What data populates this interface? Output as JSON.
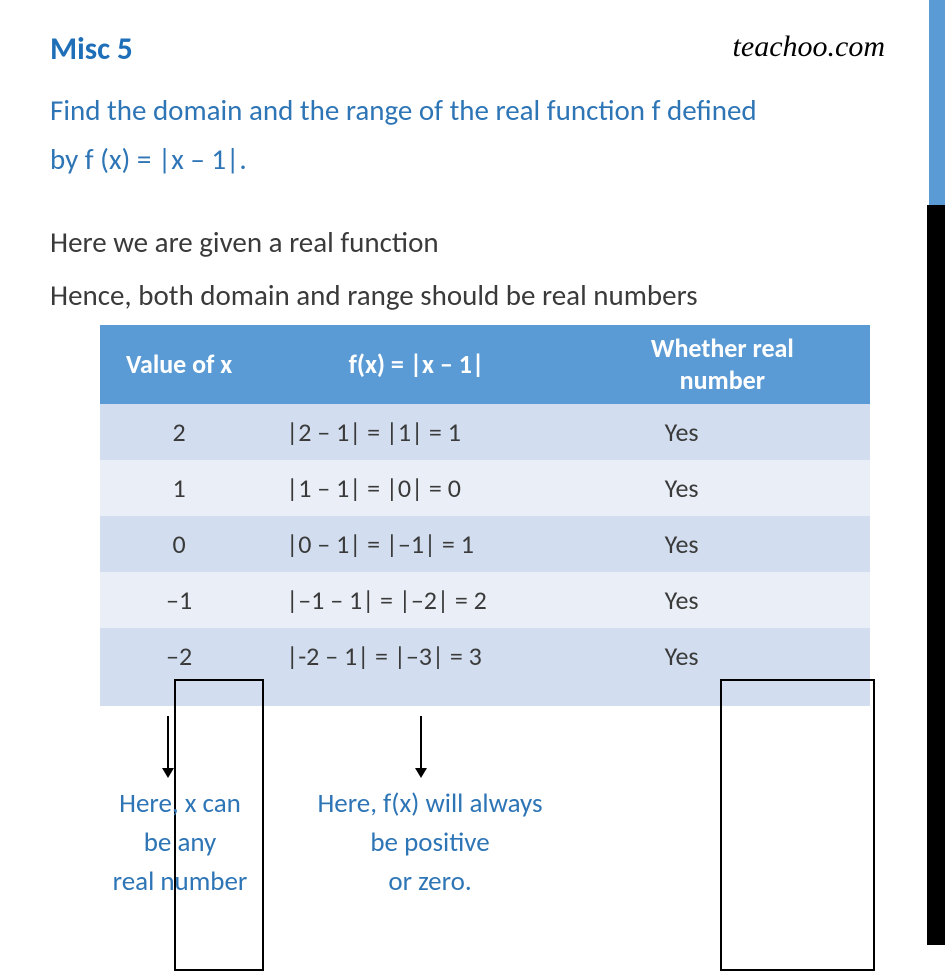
{
  "brand": "teachoo.com",
  "title": "Misc  5",
  "problem_line1": "Find the domain and the range of the real function f defined",
  "problem_line2": "by f (x) = |x – 1|.",
  "solution_line1": "Here we are given a real function",
  "solution_line2": "Hence, both domain and range should be real numbers",
  "table": {
    "headers": {
      "col1": "Value of x",
      "col2": "f(x) = |x – 1|",
      "col3_l1": "Whether real",
      "col3_l2": "number"
    },
    "rows": [
      {
        "x": "2",
        "fx": "|2 – 1| = |1| = 1",
        "real": "Yes"
      },
      {
        "x": "1",
        "fx": "|1 – 1| = |0| = 0",
        "real": "Yes"
      },
      {
        "x": "0",
        "fx": "|0 – 1| = |–1| = 1",
        "real": "Yes"
      },
      {
        "x": "–1",
        "fx": "|–1 – 1| = |–2| = 2",
        "real": "Yes"
      },
      {
        "x": "–2",
        "fx": "|-2 – 1| = |–3| = 3",
        "real": "Yes"
      }
    ]
  },
  "notes": {
    "left_l1": "Here, x can",
    "left_l2": "be any",
    "left_l3": "real number",
    "right_l1": "Here, f(x) will always",
    "right_l2": "be positive",
    "right_l3": "or zero."
  }
}
